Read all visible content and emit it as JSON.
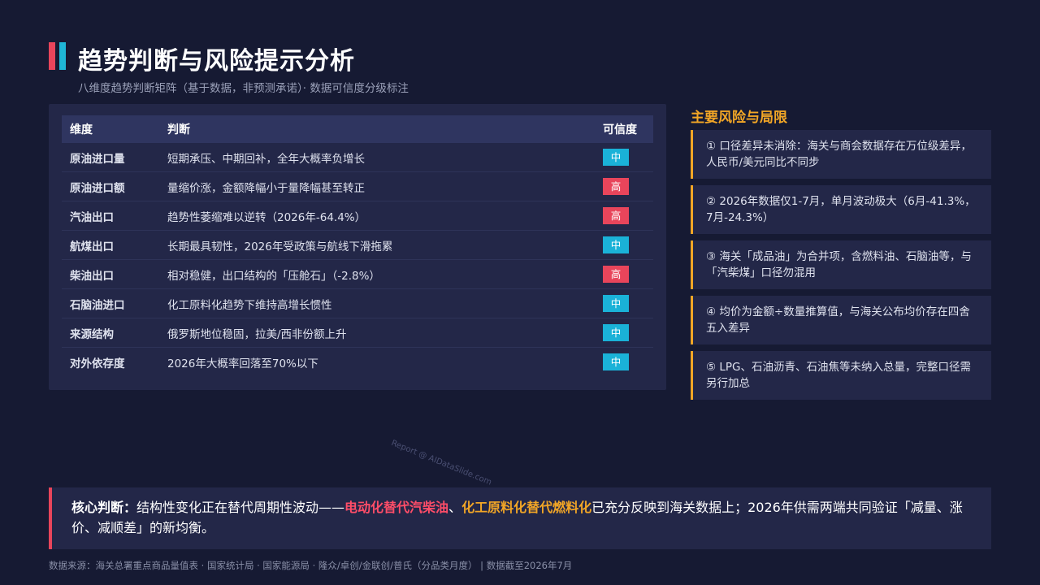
{
  "header": {
    "title": "趋势判断与风险提示分析",
    "subtitle": "八维度趋势判断矩阵（基于数据，非预测承诺）· 数据可信度分级标注"
  },
  "table": {
    "columns": [
      "维度",
      "判断",
      "可信度"
    ],
    "rows": [
      {
        "dimension": "原油进口量",
        "judgment": "短期承压、中期回补，全年大概率负增长",
        "confidence": "中"
      },
      {
        "dimension": "原油进口额",
        "judgment": "量缩价涨，金额降幅小于量降幅甚至转正",
        "confidence": "高"
      },
      {
        "dimension": "汽油出口",
        "judgment": "趋势性萎缩难以逆转（2026年-64.4%）",
        "confidence": "高"
      },
      {
        "dimension": "航煤出口",
        "judgment": "长期最具韧性，2026年受政策与航线下滑拖累",
        "confidence": "中"
      },
      {
        "dimension": "柴油出口",
        "judgment": "相对稳健，出口结构的「压舱石」（-2.8%）",
        "confidence": "高"
      },
      {
        "dimension": "石脑油进口",
        "judgment": "化工原料化趋势下维持高增长惯性",
        "confidence": "中"
      },
      {
        "dimension": "来源结构",
        "judgment": "俄罗斯地位稳固，拉美/西非份额上升",
        "confidence": "中"
      },
      {
        "dimension": "对外依存度",
        "judgment": "2026年大概率回落至70%以下",
        "confidence": "中"
      }
    ]
  },
  "risks": {
    "title": "主要风险与局限",
    "items": [
      "① 口径差异未消除：海关与商会数据存在万位级差异，人民币/美元同比不同步",
      "② 2026年数据仅1-7月，单月波动极大（6月-41.3%，7月-24.3%）",
      "③ 海关「成品油」为合并项，含燃料油、石脑油等，与「汽柴煤」口径勿混用",
      "④ 均价为金额÷数量推算值，与海关公布均价存在四舍五入差异",
      "⑤ LPG、石油沥青、石油焦等未纳入总量，完整口径需另行加总"
    ]
  },
  "watermark": "Report @ AIDataSlide.com",
  "core": {
    "lead": "核心判断：",
    "text1": "结构性变化正在替代周期性波动——",
    "hl1": "电动化替代汽柴油",
    "sep": "、",
    "hl2": "化工原料化替代燃料化",
    "text2": "已充分反映到海关数据上；2026年供需两端共同验证「减量、涨价、减顺差」的新均衡。"
  },
  "source": "数据来源：海关总署重点商品量值表 · 国家统计局 · 国家能源局 · 隆众/卓创/金联创/普氏（分品类月度） | 数据截至2026年7月",
  "colors": {
    "background": "#161a33",
    "card": "#232748",
    "accent_red": "#e8455b",
    "accent_cyan": "#1fb6d6",
    "accent_amber": "#f2a626",
    "badge_mid": "#1ab2d8",
    "badge_high": "#e8455b"
  }
}
